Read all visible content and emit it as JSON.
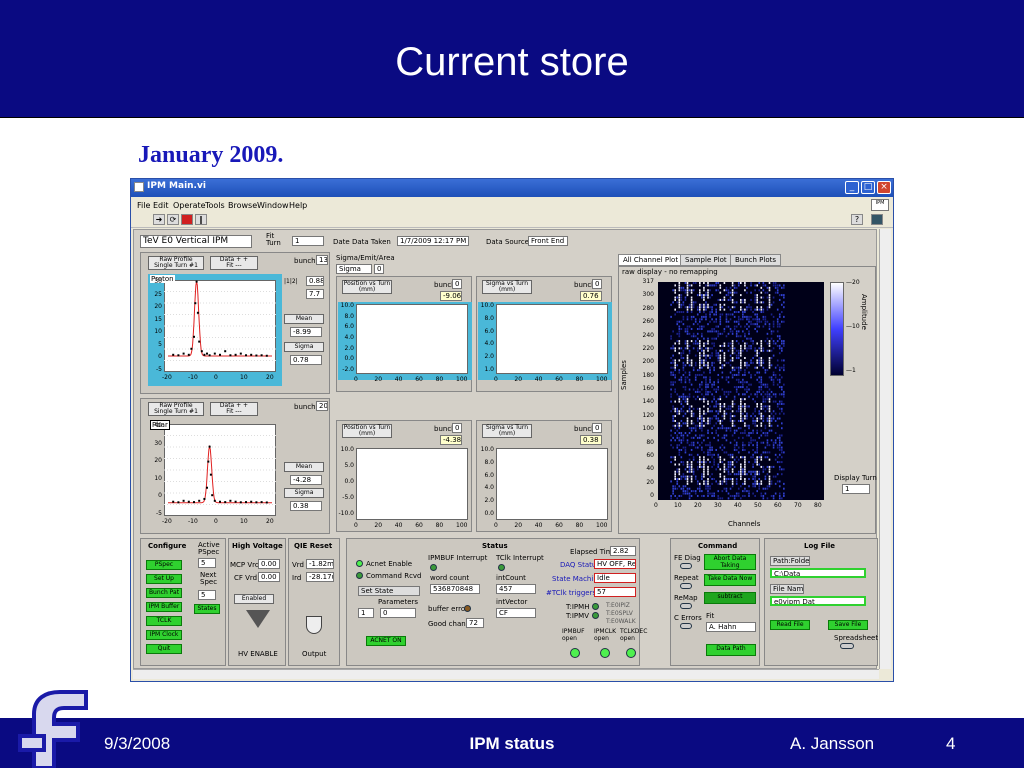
{
  "slide": {
    "title": "Current store",
    "subtitle": "January 2009.",
    "footer_date": "9/3/2008",
    "footer_center": "IPM status",
    "footer_author": "A. Jansson",
    "page_number": "4"
  },
  "window": {
    "title": "IPM Main.vi",
    "menu": [
      "File",
      "Edit",
      "Operate",
      "Tools",
      "Browse",
      "Window",
      "Help"
    ]
  },
  "header": {
    "instrument": "TeV E0 Vertical IPM",
    "fit_label": "Fit\nTurn",
    "fit_turn": "1",
    "date_label": "Date  Data Taken",
    "date_value": "1/7/2009 12:17 PM",
    "source_label": "Data Source",
    "source_value": "Front End"
  },
  "upper_profile": {
    "raw_btn": "Raw Profile\nSingle Turn #1",
    "data_btn": "Data  + +\nFit  ---",
    "bunch_label": "bunch",
    "bunch_value": "13",
    "species": "Proton",
    "mean_label": "Mean",
    "mean_value": "-8.99",
    "sigma_label": "Sigma",
    "sigma_value": "0.78",
    "y_ticks": [
      "30",
      "25",
      "20",
      "15",
      "10",
      "5",
      "0",
      "-5"
    ],
    "x_ticks": [
      "-20",
      "-10",
      "0",
      "10",
      "20"
    ],
    "scale_a": "0.88",
    "scale_b": "7.7"
  },
  "lower_profile": {
    "raw_btn": "Raw Profile\nSingle Turn #1",
    "data_btn": "Data  + +\nFit  ---",
    "bunch_label": "bunch",
    "bunch_value": "20",
    "species": "Pbar",
    "mean_label": "Mean",
    "mean_value": "-4.28",
    "sigma_label": "Sigma",
    "sigma_value": "0.38",
    "y_ticks": [
      "40",
      "30",
      "20",
      "10",
      "0",
      "-5"
    ],
    "x_ticks": [
      "-20",
      "-10",
      "0",
      "10",
      "20"
    ]
  },
  "sigma_emit": {
    "label": "Sigma/Emit/Area",
    "selected": "Sigma",
    "value": "0"
  },
  "upper_pos": {
    "title": "Position vs Turn\n(mm)",
    "bunch_label": "bunch",
    "bunch_value": "0",
    "readout": "-9.06",
    "y_ticks": [
      "10.0",
      "8.0",
      "6.0",
      "4.0",
      "2.0",
      "0.0",
      "-2.0"
    ],
    "x_ticks": [
      "0",
      "20",
      "40",
      "60",
      "80",
      "100"
    ]
  },
  "upper_sig": {
    "title": "Sigma vs Turn\n(mm)",
    "bunch_label": "bunch",
    "bunch_value": "0",
    "readout": "0.76",
    "y_ticks": [
      "10.0",
      "8.0",
      "6.0",
      "4.0",
      "2.0",
      "1.0"
    ],
    "x_ticks": [
      "0",
      "20",
      "40",
      "60",
      "80",
      "100"
    ]
  },
  "lower_pos": {
    "title": "Position vs Turn\n(mm)",
    "bunch_label": "bunch",
    "bunch_value": "0",
    "readout": "-4.38",
    "y_ticks": [
      "10.0",
      "5.0",
      "0.0",
      "-5.0",
      "-10.0"
    ],
    "x_ticks": [
      "0",
      "20",
      "40",
      "60",
      "80",
      "100"
    ]
  },
  "lower_sig": {
    "title": "Sigma vs Turn\n(mm)",
    "bunch_label": "bunch",
    "bunch_value": "0",
    "readout": "0.38",
    "y_ticks": [
      "10.0",
      "8.0",
      "6.0",
      "4.0",
      "2.0",
      "0.0"
    ],
    "x_ticks": [
      "0",
      "20",
      "40",
      "60",
      "80",
      "100"
    ]
  },
  "tabs": [
    "All Channel Plot",
    "Sample Plot",
    "Bunch Plots"
  ],
  "heatmap": {
    "caption": "raw display - no remapping",
    "y_label": "Samples",
    "x_label": "Channels",
    "amp_label": "Amplitude",
    "y_ticks": [
      "317",
      "300",
      "280",
      "260",
      "240",
      "220",
      "200",
      "180",
      "160",
      "140",
      "120",
      "100",
      "80",
      "60",
      "40",
      "20",
      "0"
    ],
    "x_ticks": [
      "0",
      "10",
      "20",
      "30",
      "40",
      "50",
      "60",
      "70",
      "80"
    ],
    "scale_ticks": [
      "20",
      "10",
      "1"
    ],
    "display_turn_label": "Display Turn",
    "display_turn": "1"
  },
  "configure": {
    "title": "Configure",
    "active_label": "Active\nPSpec",
    "active_value": "5",
    "next_label": "Next\nSpec",
    "next_value": "5",
    "buttons": [
      "PSpec",
      "Set Up",
      "Bunch Pat",
      "IPM Buffer",
      "TCLK",
      "IPM Clock",
      "Quit"
    ],
    "states_btn": "States"
  },
  "high_voltage": {
    "title": "High Voltage",
    "mcp_label": "MCP Vrd",
    "mcp_value": "0.00",
    "cf_label": "CF Vrd",
    "cf_value": "0.00",
    "status": "Enabled",
    "enable_label": "HV ENABLE"
  },
  "qie": {
    "title": "QIE Reset",
    "vrd_label": "Vrd",
    "vrd_value": "-1.82m",
    "ird_label": "Ird",
    "ird_value": "-28.17u",
    "output_label": "Output"
  },
  "status": {
    "title": "Status",
    "acnet_enable": "Acnet Enable",
    "command_rcvd": "Command Rcvd",
    "set_state": "Set State",
    "parameters": "Parameters",
    "param_a": "1",
    "param_b": "0",
    "acnet_on": "ACNET ON",
    "ipmbuf_label": "IPMBUF Interrupt",
    "word_count_label": "word count",
    "word_count": "536870848",
    "buffer_error": "buffer error",
    "good_chans_label": "Good chans",
    "good_chans": "72",
    "tclk_label": "TClk Interrupt",
    "intcount_label": "intCount",
    "intcount": "457",
    "intvector_label": "intVector",
    "intvector": "CF",
    "elapsed_label": "Elapsed Time",
    "elapsed": "2.82",
    "daq_label": "DAQ Status",
    "daq_value": "HV OFF, Read",
    "state_label": "State Machine",
    "state_value": "Idle",
    "tclk_trig_label": "#TClk triggers",
    "tclk_trig": "57",
    "t_ipmh": "T:IPMH",
    "t_ipmv": "T:IPMV",
    "t_e0ipiz": "T:E0IPIZ",
    "t_e0splv": "T:E0SPLV",
    "t_e0walk": "T:E0WALK",
    "ipmbuf_open": "IPMBUF\nopen",
    "ipmclk_open": "IPMCLK\nopen",
    "tclkdec_open": "TCLKDEC\nopen"
  },
  "command": {
    "title": "Command",
    "fe_diag": "FE Diag",
    "repeat": "Repeat",
    "remap": "ReMap",
    "c_errors": "C Errors",
    "abort_btn": "Abort Data\nTaking",
    "take_btn": "Take Data Now",
    "subtract_btn": "subtract",
    "fit_label": "Fit",
    "fit_user": "A. Hahn",
    "data_path_btn": "Data Path"
  },
  "log": {
    "title": "Log File",
    "path_label": "Path:Folder",
    "path_value": "C:\\Data",
    "file_label": "File Name",
    "file_value": "e0vipm Dat",
    "read_btn": "Read File",
    "save_btn": "Save File",
    "spreadsheet": "Spreadsheet"
  },
  "chart_data": [
    {
      "type": "scatter",
      "title": "Raw Profile Single Turn #1 (upper)",
      "x": [
        -18,
        -16,
        -14,
        -12,
        -11,
        -10,
        -9.5,
        -9,
        -8.5,
        -8,
        -7,
        -6,
        -5,
        -4,
        -2,
        0,
        2,
        4,
        6,
        8,
        10,
        12,
        14,
        16,
        18
      ],
      "y": [
        0.5,
        0.3,
        1,
        0.5,
        3,
        8,
        22,
        31,
        18,
        6,
        2,
        0.5,
        1,
        0.3,
        1,
        0.5,
        2,
        0.3,
        0.5,
        1,
        0.3,
        0.5,
        0.2,
        0.3,
        0.1
      ],
      "ylim": [
        -5,
        30
      ],
      "xlim": [
        -20,
        20
      ]
    },
    {
      "type": "scatter",
      "title": "Raw Profile Single Turn #1 (lower)",
      "x": [
        -18,
        -16,
        -14,
        -12,
        -10,
        -8,
        -6,
        -5,
        -4.5,
        -4,
        -3.5,
        -3,
        -2,
        0,
        2,
        4,
        6,
        8,
        10,
        12,
        14,
        16,
        18
      ],
      "y": [
        0.5,
        0.2,
        1,
        0.5,
        0.3,
        1,
        2,
        8,
        22,
        30,
        15,
        4,
        1,
        0.5,
        0.3,
        1,
        0.5,
        0.2,
        0.3,
        0.5,
        0.2,
        0.3,
        0.1
      ],
      "ylim": [
        -5,
        40
      ],
      "xlim": [
        -20,
        20
      ]
    },
    {
      "type": "heatmap",
      "xlim": [
        0,
        80
      ],
      "ylim": [
        0,
        317
      ],
      "scale": [
        1,
        20
      ]
    }
  ]
}
